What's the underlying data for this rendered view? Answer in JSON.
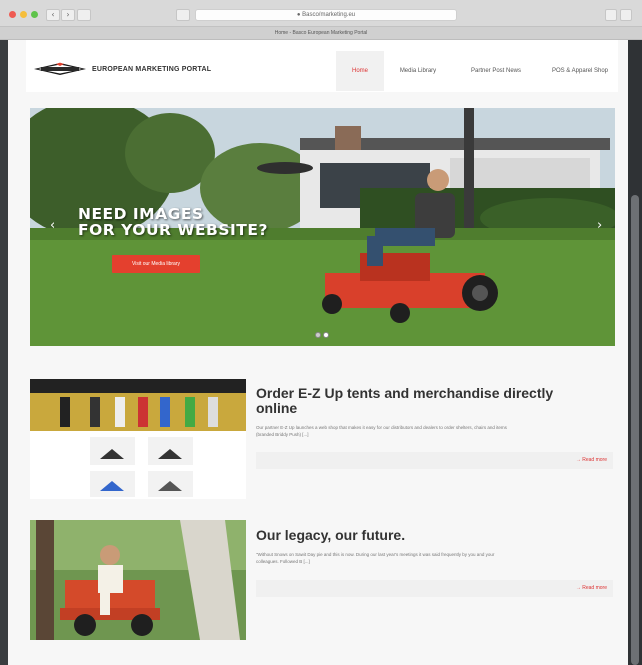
{
  "browser": {
    "url": "● Basco/marketing.eu",
    "tab_title": "Home - Basco European Marketing Portal",
    "back_glyph": "‹",
    "forward_glyph": "›"
  },
  "site": {
    "portal_title": "EUROPEAN MARKETING PORTAL",
    "nav": [
      {
        "label": "Home",
        "active": true
      },
      {
        "label": "Media Library",
        "active": false
      },
      {
        "label": "Partner Post News",
        "active": false
      },
      {
        "label": "POS & Apparel Shop",
        "active": false
      }
    ]
  },
  "hero": {
    "headline_line1": "NEED IMAGES",
    "headline_line2": "FOR YOUR WEBSITE?",
    "button_label": "Visit our Media library",
    "prev_icon": "‹",
    "next_icon": "›",
    "slide_count": 2
  },
  "articles": [
    {
      "title_line1": "Order E-Z Up tents and merchandise directly",
      "title_line2": "online",
      "excerpt_line1": "Our partner E-Z Up launches a web shop that makes it easy for our distributors and dealers to order shelters, chairs and items",
      "excerpt_line2": "(branded Briddy Push) [...]",
      "read_more": "→ Read more"
    },
    {
      "title_line1": "Our legacy, our future.",
      "title_line2": "",
      "excerpt_line1": "\"Without Snows on Sawit Day pie and this is now. During our last year's meetings it was said frequently by you and your",
      "excerpt_line2": "colleagues. Followed B [...]",
      "read_more": "→ Read more"
    }
  ],
  "colors": {
    "accent": "#e4402e",
    "active_nav": "#dd3333"
  }
}
